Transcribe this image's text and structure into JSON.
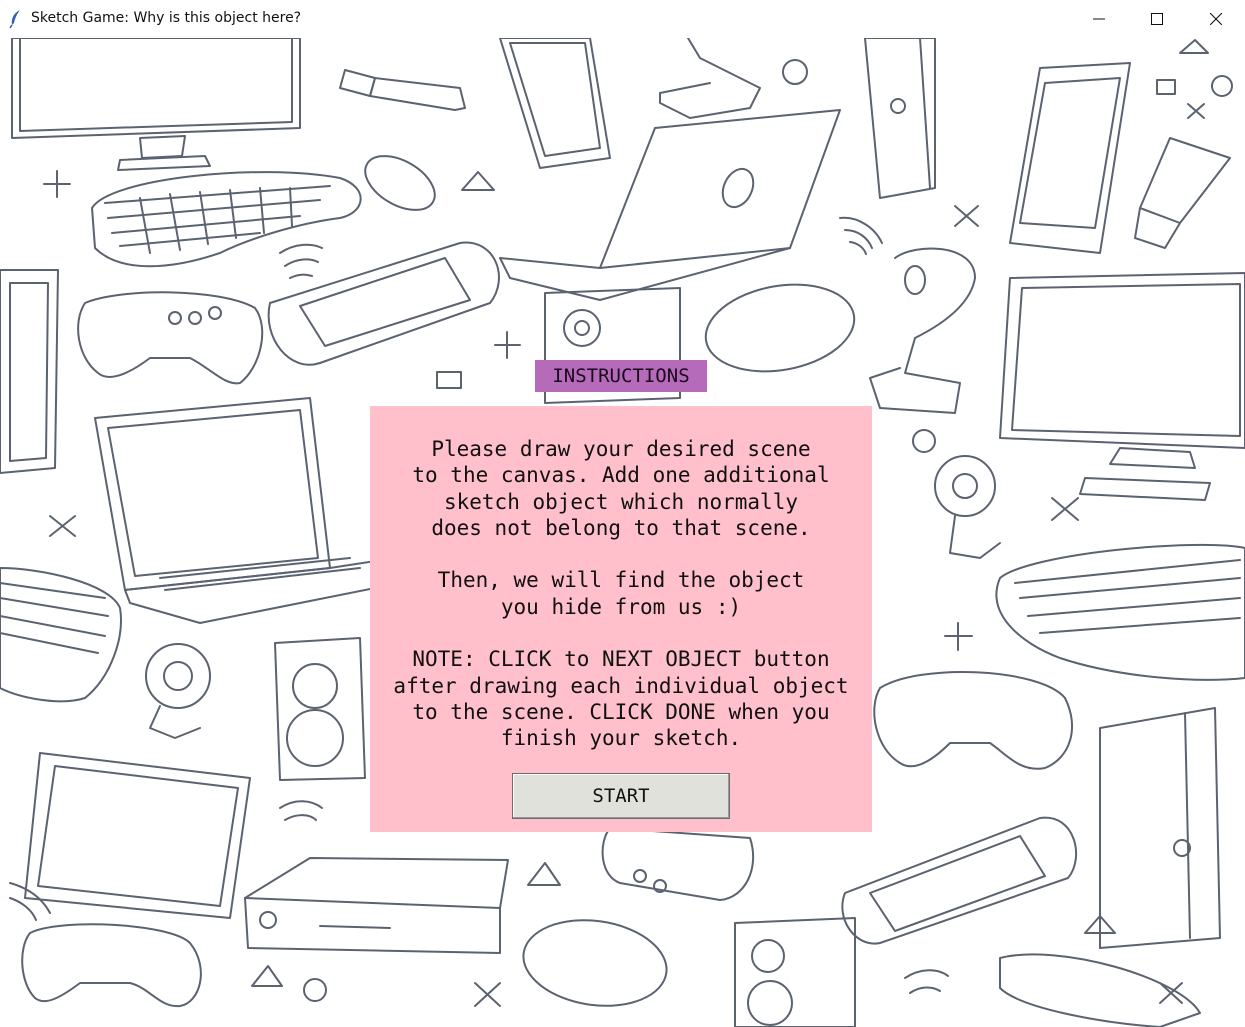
{
  "window": {
    "title": "Sketch Game: Why is this object here?",
    "controls": {
      "minimize": "minimize-icon",
      "maximize": "maximize-icon",
      "close": "close-icon"
    }
  },
  "instructions": {
    "label": "INSTRUCTIONS",
    "body": "Please draw your desired scene\nto the canvas. Add one additional\nsketch object which normally\ndoes not belong to that scene.\n\nThen, we will find the object\nyou hide from us :)\n\nNOTE: CLICK to NEXT OBJECT button\nafter drawing each individual object\nto the scene. CLICK DONE when you\nfinish your sketch.",
    "start_label": "START"
  },
  "colors": {
    "label_bg": "#b56aba",
    "panel_bg": "#ffc0cb",
    "button_bg": "#e1e1dc",
    "sketch_stroke": "#5b6270"
  }
}
